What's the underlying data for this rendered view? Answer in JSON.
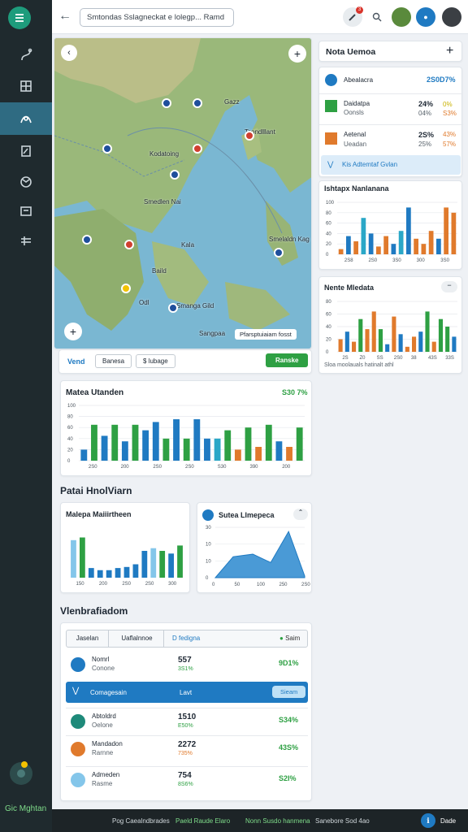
{
  "sidebar": {
    "brand": "Gic Mghtan"
  },
  "topbar": {
    "search_text": "Smtondas Sslagneckat e lolegp...   Ramd",
    "notif_count": "3"
  },
  "map": {
    "labels": [
      "Gazz",
      "Tsondlllant",
      "Kodatoing",
      "Smedlen Nai",
      "Kala",
      "Baild",
      "Smelaldn Kag",
      "Odl",
      "Smanga Gild",
      "Sangpaa"
    ],
    "legend": "Pfarsptuiaiam fosst",
    "toolbar": {
      "tab1": "Vend",
      "tab2": "Banesa",
      "tab3": "$ lubage",
      "action": "Ranske"
    }
  },
  "right_panel": {
    "title": "Nota Uemoa",
    "rows": [
      {
        "name": "Abealacra",
        "value": "2S0D7%",
        "extra": ""
      },
      {
        "name": "Daidatpa",
        "sub": "Oonsls",
        "value": "24%",
        "value2": "04%",
        "pct": "0%",
        "pct2": "S3%"
      },
      {
        "name": "Aetenal",
        "sub": "Ueadan",
        "value": "2S%",
        "value2": "25%",
        "pct": "43%",
        "pct2": "57%"
      }
    ],
    "info_bar": "Kis Adtemtaf Gvlan"
  },
  "chart_right1": {
    "title": "Ishtapx Nanlanana"
  },
  "chart_right2": {
    "title": "Nente Mledata",
    "caption": "Sloa moolauals hatinalt athl"
  },
  "chart_main": {
    "title": "Matea Utanden",
    "badge": "S30 7%"
  },
  "section1": {
    "title": "Patai HnolViarn"
  },
  "chart_small1": {
    "title": "Malepa Maiiirtheen"
  },
  "chart_small2": {
    "title": "Sutea Llmepeca"
  },
  "section2": {
    "title": "Vlenbrafiadom"
  },
  "table": {
    "tabs": [
      "Jaselan",
      "Uaflalnnoe",
      "D fedigna"
    ],
    "tab_action": "Saim",
    "rows": [
      {
        "name": "Nomrl",
        "sub": "Conone",
        "value": "557",
        "pct": "3S1%",
        "right": "9D1%"
      },
      {
        "name": "Abtoldrd",
        "sub": "Oelone",
        "value": "1510",
        "pct": "E50%",
        "right": "S34%"
      },
      {
        "name": "Mandadon",
        "sub": "Rarnne",
        "value": "2272",
        "pct": "735%",
        "right": "43S%"
      },
      {
        "name": "Admeden",
        "sub": "Rasme",
        "value": "754",
        "pct": "8S6%",
        "right": "S2I%"
      }
    ],
    "highlight": {
      "name": "Comagesain",
      "mid": "Lavt",
      "button": "Sieam"
    }
  },
  "footer": {
    "items": [
      "Pog Caealndbrades",
      "Paeld Raude Elaro",
      "Nonn Susdo hanmena",
      "Sanebore Sod 4ao"
    ],
    "right": "Dade"
  },
  "colors": {
    "accent": "#1f7ac2",
    "green": "#2ea043",
    "orange": "#e07a2c",
    "sidebar": "#1f2a2e"
  },
  "chart_data": [
    {
      "type": "bar",
      "title": "Ishtapx Nanlanana",
      "x_ticks": [
        "100",
        "80",
        "60",
        "40",
        "20",
        "0"
      ],
      "categories": [
        "2S8",
        "2S0",
        "3S0",
        "300",
        "3S0"
      ],
      "values": [
        10,
        35,
        25,
        70,
        40,
        15,
        35,
        20,
        45,
        90,
        30,
        20,
        45,
        30,
        90,
        80
      ],
      "colors": [
        "#e07a2c",
        "#1f7ac2",
        "#e07a2c",
        "#2aa7c7",
        "#1f7ac2",
        "#e07a2c",
        "#e07a2c",
        "#1f7ac2",
        "#2aa7c7",
        "#1f7ac2",
        "#e07a2c",
        "#e07a2c",
        "#e07a2c",
        "#1f7ac2",
        "#e07a2c",
        "#e07a2c"
      ]
    },
    {
      "type": "bar",
      "title": "Nente Mledata",
      "x_ticks": [
        "80",
        "60",
        "40",
        "20",
        "0"
      ],
      "categories": [
        "2S",
        "Z0",
        "SS",
        "2S0",
        "38",
        "43S",
        "33S"
      ],
      "values": [
        25,
        40,
        20,
        65,
        45,
        80,
        45,
        15,
        70,
        35,
        10,
        30,
        40,
        80,
        20,
        65,
        50,
        30
      ],
      "colors": [
        "#e07a2c",
        "#1f7ac2",
        "#e07a2c",
        "#2ea043",
        "#e07a2c",
        "#e07a2c",
        "#2ea043",
        "#1f7ac2",
        "#e07a2c",
        "#1f7ac2",
        "#e07a2c",
        "#e07a2c",
        "#1f7ac2",
        "#2ea043",
        "#e07a2c",
        "#2ea043",
        "#2ea043",
        "#1f7ac2"
      ]
    },
    {
      "type": "bar",
      "title": "Matea Utanden",
      "x_ticks": [
        "100",
        "80",
        "60",
        "40",
        "20",
        "0"
      ],
      "categories": [
        "2S0",
        "200",
        "2S0",
        "2S0",
        "S30",
        "390",
        "200"
      ],
      "values": [
        20,
        65,
        45,
        65,
        35,
        65,
        55,
        70,
        40,
        75,
        40,
        75,
        40,
        40,
        55,
        20,
        60,
        25,
        65,
        35,
        25,
        60
      ],
      "colors": [
        "#1f7ac2",
        "#2ea043",
        "#1f7ac2",
        "#2ea043",
        "#1f7ac2",
        "#2ea043",
        "#1f7ac2",
        "#1f7ac2",
        "#2ea043",
        "#1f7ac2",
        "#2ea043",
        "#1f7ac2",
        "#1f7ac2",
        "#2aa7c7",
        "#2ea043",
        "#e07a2c",
        "#2ea043",
        "#e07a2c",
        "#2ea043",
        "#1f7ac2",
        "#e07a2c",
        "#2ea043"
      ]
    },
    {
      "type": "bar",
      "title": "Malepa Maiiirtheen",
      "categories": [
        "150",
        "200",
        "2S0",
        "2S0",
        "300"
      ],
      "values": [
        70,
        75,
        18,
        14,
        14,
        18,
        20,
        25,
        50,
        55,
        50,
        45,
        60
      ],
      "colors": [
        "#84c6ea",
        "#2ea043",
        "#1f7ac2",
        "#1f7ac2",
        "#1f7ac2",
        "#1f7ac2",
        "#1f7ac2",
        "#1f7ac2",
        "#1f7ac2",
        "#84c6ea",
        "#2ea043",
        "#1f7ac2",
        "#2ea043"
      ]
    },
    {
      "type": "area",
      "title": "Sutea Llmepeca",
      "x_ticks": [
        "0",
        "50",
        "100",
        "250",
        "2S0"
      ],
      "y_ticks": [
        "30",
        "10",
        "10",
        "0"
      ],
      "points": [
        [
          0,
          0
        ],
        [
          20,
          25
        ],
        [
          42,
          28
        ],
        [
          62,
          18
        ],
        [
          82,
          55
        ],
        [
          100,
          2
        ]
      ]
    }
  ]
}
